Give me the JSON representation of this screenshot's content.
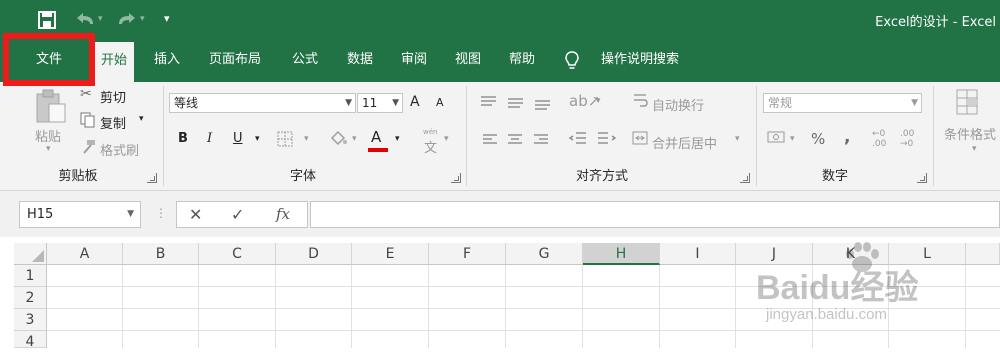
{
  "window": {
    "title": "Excel的设计  -  Excel"
  },
  "qat": {
    "save_icon": "save-icon",
    "undo_icon": "undo-icon",
    "redo_icon": "redo-icon",
    "customize_icon": "customize-qat-icon"
  },
  "tabs": [
    {
      "label": "文件"
    },
    {
      "label": "开始"
    },
    {
      "label": "插入"
    },
    {
      "label": "页面布局"
    },
    {
      "label": "公式"
    },
    {
      "label": "数据"
    },
    {
      "label": "审阅"
    },
    {
      "label": "视图"
    },
    {
      "label": "帮助"
    }
  ],
  "tell_me": {
    "icon": "lightbulb-icon",
    "label": "操作说明搜索"
  },
  "clipboard": {
    "paste": "粘贴",
    "cut": "剪切",
    "copy": "复制",
    "format_painter": "格式刷",
    "group_label": "剪贴板"
  },
  "font": {
    "name": "等线",
    "size": "11",
    "grow": "A",
    "shrink": "A",
    "bold": "B",
    "italic": "I",
    "underline": "U",
    "font_color_letter": "A",
    "phonetic": "文",
    "group_label": "字体"
  },
  "alignment": {
    "wrap_text": "自动换行",
    "merge_center": "合并后居中",
    "group_label": "对齐方式"
  },
  "number": {
    "format": "常规",
    "percent": "%",
    "comma": ",",
    "inc_decimal": "←0 .00",
    "dec_decimal": ".00 →0",
    "group_label": "数字"
  },
  "styles": {
    "conditional": "条件格式"
  },
  "formula_bar": {
    "name_box": "H15",
    "cancel": "✕",
    "enter": "✓",
    "fx": "fx",
    "value": ""
  },
  "columns": [
    "A",
    "B",
    "C",
    "D",
    "E",
    "F",
    "G",
    "H",
    "I",
    "J",
    "K",
    "L"
  ],
  "selected_column": "H",
  "rows": [
    "1",
    "2",
    "3",
    "4"
  ],
  "watermark": {
    "brand": "Baidu经验",
    "url": "jingyan.baidu.com"
  },
  "colors": {
    "excel_green": "#217346",
    "highlight_red": "#ef1b1b",
    "font_color_red": "#e00000"
  }
}
